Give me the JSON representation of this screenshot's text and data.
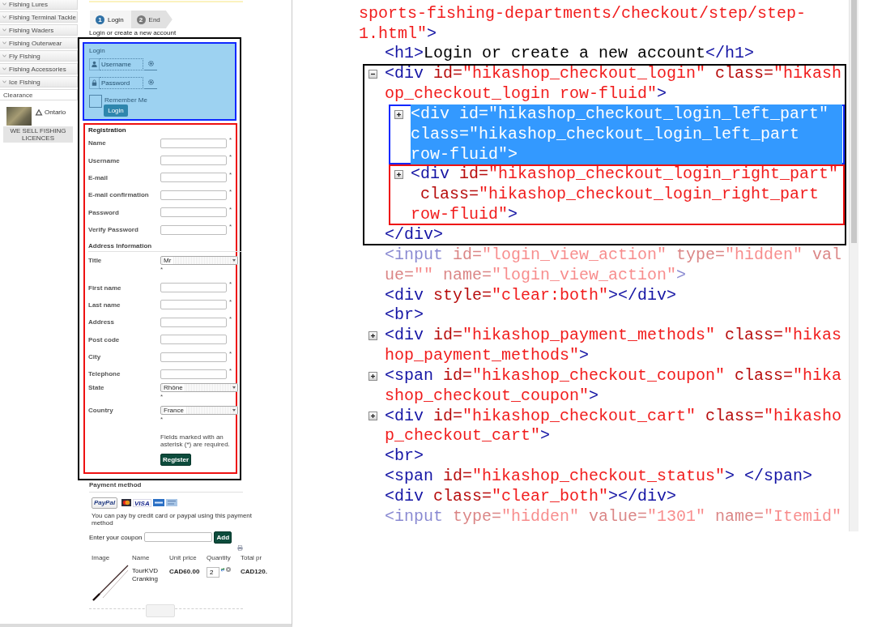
{
  "sidebar": {
    "items": [
      {
        "kind": "category",
        "label": "Fishing Lures"
      },
      {
        "kind": "category",
        "label": "Fishing Terminal Tackle"
      },
      {
        "kind": "category",
        "label": "Fishing Waders"
      },
      {
        "kind": "category",
        "label": "Fishing Outerwear"
      },
      {
        "kind": "category",
        "label": "Fly Fishing"
      },
      {
        "kind": "category",
        "label": "Fishing Accessories"
      },
      {
        "kind": "category",
        "label": "Ice Fishing"
      },
      {
        "kind": "link",
        "label": "Clearance"
      }
    ],
    "banner": {
      "logo": "Ontario",
      "caption": "WE SELL FISHING LICENCES"
    }
  },
  "steps": [
    {
      "number": "1",
      "label": "Login",
      "selected": true
    },
    {
      "number": "2",
      "label": "End",
      "selected": false
    }
  ],
  "heading": "Login or create a new account",
  "account": {
    "color": "#000000",
    "login": {
      "color": "#1028ff",
      "highlighted": true,
      "title": "Login",
      "username_placeholder": "Username",
      "password_placeholder": "Password",
      "remember_label": "Remember Me",
      "remember_checked": false,
      "button": "Login"
    },
    "registration": {
      "color": "#ee1111",
      "title": "Registration",
      "fields": [
        {
          "kind": "input",
          "label": "Name",
          "mark": "*"
        },
        {
          "kind": "input",
          "label": "Username",
          "mark": "*"
        },
        {
          "kind": "input",
          "label": "E-mail",
          "mark": "*"
        },
        {
          "kind": "input",
          "label": "E-mail confirmation",
          "mark": "*"
        },
        {
          "kind": "input",
          "label": "Password",
          "mark": "*"
        },
        {
          "kind": "input",
          "label": "Verify Password",
          "mark": "*"
        }
      ],
      "address_title": "Address Information",
      "address_fields": [
        {
          "kind": "select",
          "label": "Title",
          "value": "Mr",
          "mark": "*"
        },
        {
          "kind": "input",
          "label": "First name",
          "mark": "*"
        },
        {
          "kind": "input",
          "label": "Last name",
          "mark": "*"
        },
        {
          "kind": "input",
          "label": "Address",
          "mark": "*"
        },
        {
          "kind": "input",
          "label": "Post code"
        },
        {
          "kind": "input",
          "label": "City",
          "mark": "*"
        },
        {
          "kind": "input",
          "label": "Telephone",
          "mark": "*"
        },
        {
          "kind": "select",
          "label": "State",
          "value": "Rhône",
          "mark": "*"
        },
        {
          "kind": "select",
          "label": "Country",
          "value": "France",
          "mark": "*"
        }
      ],
      "note": "Fields marked with an asterisk (*) are required.",
      "button": "Register"
    }
  },
  "payment": {
    "title": "Payment method",
    "paypal": "PayPal",
    "cards": [
      {
        "kind": "circles"
      },
      {
        "kind": "text",
        "label": "VISA"
      },
      {
        "kind": "blue"
      },
      {
        "kind": "pale"
      }
    ],
    "note": "You can pay by credit card or paypal using this payment method"
  },
  "coupon": {
    "label": "Enter your coupon",
    "button": "Add"
  },
  "cart": {
    "columns": [
      "Image",
      "Name",
      "Unit price",
      "Quantity",
      "Total pr"
    ],
    "rows": [
      {
        "name": "TourKVD Cranking",
        "unit_price": "CAD60.00",
        "quantity": "2",
        "total": "CAD120."
      }
    ]
  },
  "code_view": {
    "root": {
      "lines": [
        [
          {
            "kind": "value",
            "text": "sports-fishing-departments/checkout/step/step-"
          }
        ],
        [
          {
            "kind": "value",
            "text": "1.html\""
          },
          {
            "kind": "tag",
            "text": ">"
          }
        ]
      ],
      "children": [
        {
          "selected": false,
          "greyed": false,
          "lines": [
            [
              {
                "kind": "tag",
                "text": "<h1>"
              },
              {
                "kind": "text",
                "text": "Login or create a new account"
              },
              {
                "kind": "tag",
                "text": "</h1>"
              }
            ]
          ]
        },
        {
          "selected": false,
          "greyed": false,
          "expanded": true,
          "color": "#000000",
          "lines": [
            [
              {
                "kind": "tag",
                "text": "<div"
              },
              {
                "kind": "attr",
                "text": " id="
              },
              {
                "kind": "value",
                "text": "\"hikashop_checkout_login\""
              },
              {
                "kind": "attr",
                "text": " class="
              },
              {
                "kind": "value",
                "text": "\"hikash"
              }
            ],
            [
              {
                "kind": "value",
                "text": "op_checkout_login row-fluid\""
              },
              {
                "kind": "tag",
                "text": ">"
              }
            ]
          ],
          "children": [
            {
              "selected": true,
              "greyed": false,
              "expanded": false,
              "color": "#1028ff",
              "lines": [
                [
                  {
                    "kind": "tag",
                    "text": "<div"
                  },
                  {
                    "kind": "attr",
                    "text": " id="
                  },
                  {
                    "kind": "value",
                    "text": "\"hikashop_checkout_login_left_part\""
                  }
                ],
                [
                  {
                    "kind": "attr",
                    "text": "class="
                  },
                  {
                    "kind": "value",
                    "text": "\"hikashop_checkout_login_left_part"
                  }
                ],
                [
                  {
                    "kind": "value",
                    "text": "row-fluid\""
                  },
                  {
                    "kind": "tag",
                    "text": ">"
                  }
                ]
              ]
            },
            {
              "selected": false,
              "greyed": false,
              "expanded": false,
              "color": "#ee1111",
              "lines": [
                [
                  {
                    "kind": "tag",
                    "text": "<div"
                  },
                  {
                    "kind": "attr",
                    "text": " id="
                  },
                  {
                    "kind": "value",
                    "text": "\"hikashop_checkout_login_right_part\""
                  }
                ],
                [
                  {
                    "kind": "attr",
                    "text": " class="
                  },
                  {
                    "kind": "value",
                    "text": "\"hikashop_checkout_login_right_part"
                  }
                ],
                [
                  {
                    "kind": "value",
                    "text": "row-fluid\""
                  },
                  {
                    "kind": "tag",
                    "text": ">"
                  }
                ]
              ]
            }
          ],
          "closing": [
            [
              {
                "kind": "tag",
                "text": "</div>"
              }
            ]
          ]
        },
        {
          "selected": false,
          "greyed": true,
          "lines": [
            [
              {
                "kind": "tag",
                "text": "<input"
              },
              {
                "kind": "attr",
                "text": " id="
              },
              {
                "kind": "value",
                "text": "\"login_view_action\""
              },
              {
                "kind": "attr",
                "text": " type="
              },
              {
                "kind": "value",
                "text": "\"hidden\""
              },
              {
                "kind": "attr",
                "text": " val"
              }
            ],
            [
              {
                "kind": "attr",
                "text": "ue="
              },
              {
                "kind": "value",
                "text": "\"\""
              },
              {
                "kind": "attr",
                "text": " name="
              },
              {
                "kind": "value",
                "text": "\"login_view_action\""
              },
              {
                "kind": "tag",
                "text": ">"
              }
            ]
          ]
        },
        {
          "selected": false,
          "greyed": false,
          "lines": [
            [
              {
                "kind": "tag",
                "text": "<div"
              },
              {
                "kind": "attr",
                "text": " style="
              },
              {
                "kind": "value",
                "text": "\"clear:both\""
              },
              {
                "kind": "tag",
                "text": "></div>"
              }
            ]
          ]
        },
        {
          "selected": false,
          "greyed": false,
          "lines": [
            [
              {
                "kind": "tag",
                "text": "<br>"
              }
            ]
          ]
        },
        {
          "selected": false,
          "greyed": false,
          "expanded": false,
          "lines": [
            [
              {
                "kind": "tag",
                "text": "<div"
              },
              {
                "kind": "attr",
                "text": " id="
              },
              {
                "kind": "value",
                "text": "\"hikashop_payment_methods\""
              },
              {
                "kind": "attr",
                "text": " class="
              },
              {
                "kind": "value",
                "text": "\"hikas"
              }
            ],
            [
              {
                "kind": "value",
                "text": "hop_payment_methods\""
              },
              {
                "kind": "tag",
                "text": ">"
              }
            ]
          ]
        },
        {
          "selected": false,
          "greyed": false,
          "expanded": false,
          "lines": [
            [
              {
                "kind": "tag",
                "text": "<span"
              },
              {
                "kind": "attr",
                "text": " id="
              },
              {
                "kind": "value",
                "text": "\"hikashop_checkout_coupon\""
              },
              {
                "kind": "attr",
                "text": " class="
              },
              {
                "kind": "value",
                "text": "\"hika"
              }
            ],
            [
              {
                "kind": "value",
                "text": "shop_checkout_coupon\""
              },
              {
                "kind": "tag",
                "text": ">"
              }
            ]
          ]
        },
        {
          "selected": false,
          "greyed": false,
          "expanded": false,
          "lines": [
            [
              {
                "kind": "tag",
                "text": "<div"
              },
              {
                "kind": "attr",
                "text": " id="
              },
              {
                "kind": "value",
                "text": "\"hikashop_checkout_cart\""
              },
              {
                "kind": "attr",
                "text": " class="
              },
              {
                "kind": "value",
                "text": "\"hikasho"
              }
            ],
            [
              {
                "kind": "value",
                "text": "p_checkout_cart\""
              },
              {
                "kind": "tag",
                "text": ">"
              }
            ]
          ]
        },
        {
          "selected": false,
          "greyed": false,
          "lines": [
            [
              {
                "kind": "tag",
                "text": "<br>"
              }
            ]
          ]
        },
        {
          "selected": false,
          "greyed": false,
          "lines": [
            [
              {
                "kind": "tag",
                "text": "<span"
              },
              {
                "kind": "attr",
                "text": " id="
              },
              {
                "kind": "value",
                "text": "\"hikashop_checkout_status\""
              },
              {
                "kind": "tag",
                "text": "> </span>"
              }
            ]
          ]
        },
        {
          "selected": false,
          "greyed": false,
          "lines": [
            [
              {
                "kind": "tag",
                "text": "<div"
              },
              {
                "kind": "attr",
                "text": " class="
              },
              {
                "kind": "value",
                "text": "\"clear_both\""
              },
              {
                "kind": "tag",
                "text": "></div>"
              }
            ]
          ]
        },
        {
          "selected": false,
          "greyed": true,
          "lines": [
            [
              {
                "kind": "tag",
                "text": "<input"
              },
              {
                "kind": "attr",
                "text": " type="
              },
              {
                "kind": "value",
                "text": "\"hidden\""
              },
              {
                "kind": "attr",
                "text": " value="
              },
              {
                "kind": "value",
                "text": "\"1301\""
              },
              {
                "kind": "attr",
                "text": " name="
              },
              {
                "kind": "value",
                "text": "\"Itemid\""
              }
            ]
          ]
        }
      ]
    }
  }
}
